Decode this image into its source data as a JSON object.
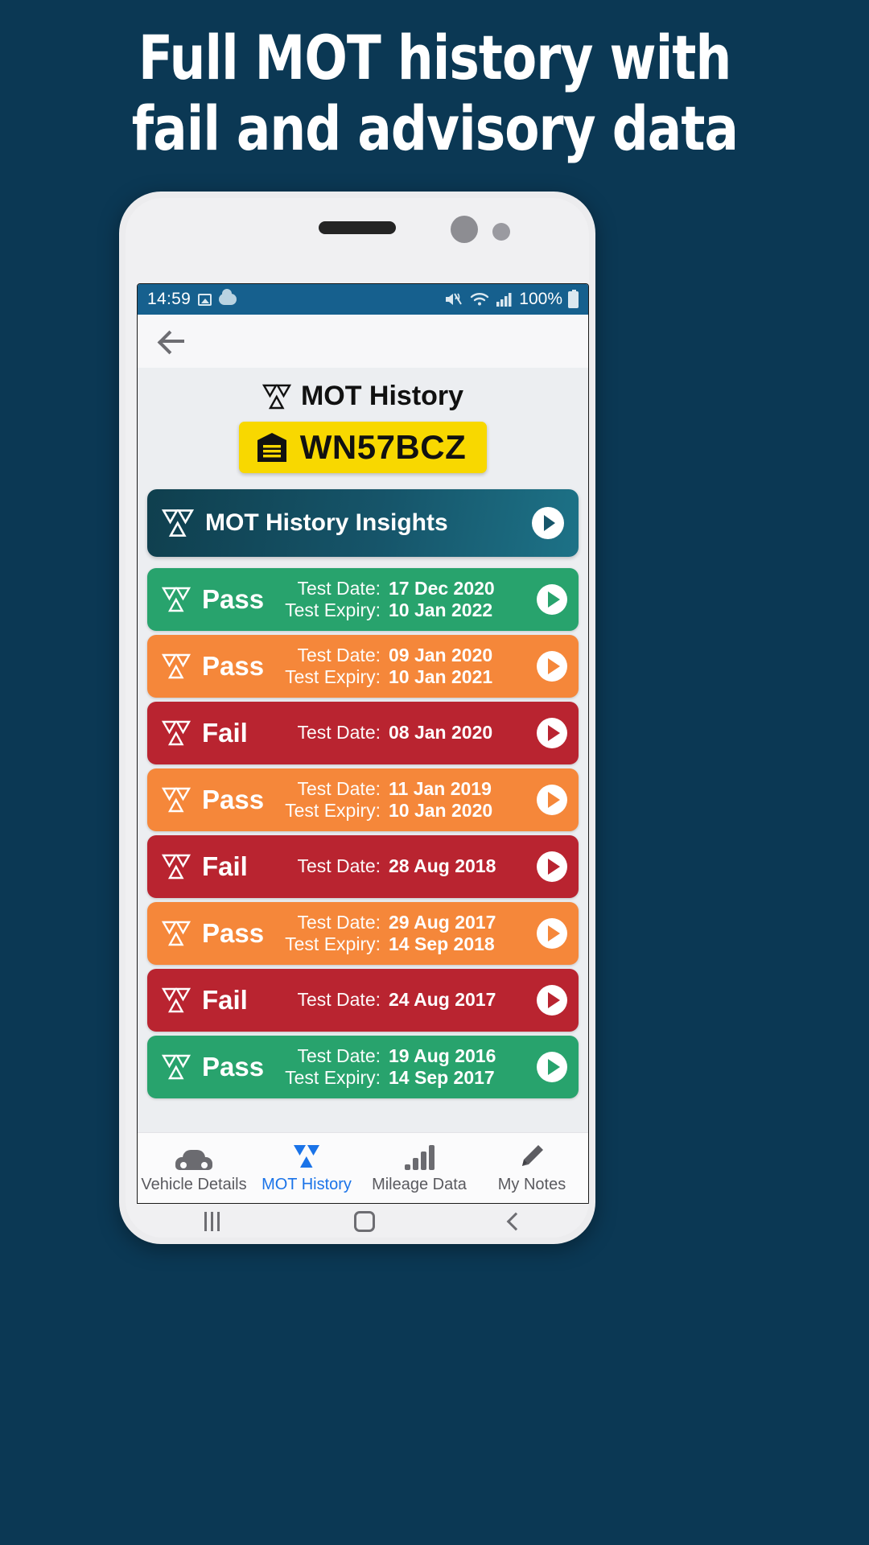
{
  "promo": {
    "line1": "Full MOT history with",
    "line2": "fail and advisory data"
  },
  "colors": {
    "background": "#0b3854",
    "statusbar": "#16608e",
    "plate_yellow": "#f8d800",
    "pass_green": "#28a36d",
    "pass_orange": "#f5873a",
    "fail_red": "#b92430",
    "accent_blue": "#1a73e8",
    "insights_gradient_start": "#0f3f4e",
    "insights_gradient_end": "#1d7287"
  },
  "statusbar": {
    "time": "14:59",
    "battery_percent": "100%",
    "icons_left": [
      "photo-icon",
      "cloud-icon"
    ],
    "icons_right": [
      "mute-icon",
      "wifi-icon",
      "signal-icon",
      "battery-icon"
    ]
  },
  "toolbar": {
    "back_label": "back-arrow-icon"
  },
  "header": {
    "title": "MOT History",
    "logo": "mot-triangle-icon",
    "plate": "WN57BCZ",
    "plate_icon": "garage-icon"
  },
  "insights": {
    "label": "MOT History Insights",
    "icon": "mot-triangle-icon",
    "chevron": "play-arrow-icon"
  },
  "labels": {
    "test_date": "Test Date:",
    "test_expiry": "Test Expiry:"
  },
  "mot_records": [
    {
      "status": "Pass",
      "test_date": "17 Dec 2020",
      "test_expiry": "10 Jan 2022",
      "style": "pass-green",
      "arrow": "ab-green"
    },
    {
      "status": "Pass",
      "test_date": "09 Jan 2020",
      "test_expiry": "10 Jan 2021",
      "style": "pass-orange",
      "arrow": "ab-orange"
    },
    {
      "status": "Fail",
      "test_date": "08 Jan 2020",
      "test_expiry": "",
      "style": "fail-red",
      "arrow": "ab-red"
    },
    {
      "status": "Pass",
      "test_date": "11 Jan 2019",
      "test_expiry": "10 Jan 2020",
      "style": "pass-orange",
      "arrow": "ab-orange"
    },
    {
      "status": "Fail",
      "test_date": "28 Aug 2018",
      "test_expiry": "",
      "style": "fail-red",
      "arrow": "ab-red"
    },
    {
      "status": "Pass",
      "test_date": "29 Aug 2017",
      "test_expiry": "14 Sep 2018",
      "style": "pass-orange",
      "arrow": "ab-orange"
    },
    {
      "status": "Fail",
      "test_date": "24 Aug 2017",
      "test_expiry": "",
      "style": "fail-red",
      "arrow": "ab-red"
    },
    {
      "status": "Pass",
      "test_date": "19 Aug 2016",
      "test_expiry": "14 Sep 2017",
      "style": "pass-green",
      "arrow": "ab-green"
    }
  ],
  "tabbar": {
    "tabs": [
      {
        "label": "Vehicle Details",
        "icon": "car-icon",
        "active": false
      },
      {
        "label": "MOT History",
        "icon": "mot-triangle-icon",
        "active": true
      },
      {
        "label": "Mileage Data",
        "icon": "bar-chart-icon",
        "active": false
      },
      {
        "label": "My Notes",
        "icon": "pencil-icon",
        "active": false
      }
    ]
  },
  "android_nav": {
    "recent": "recent-apps-icon",
    "home": "home-icon",
    "back": "back-icon"
  }
}
